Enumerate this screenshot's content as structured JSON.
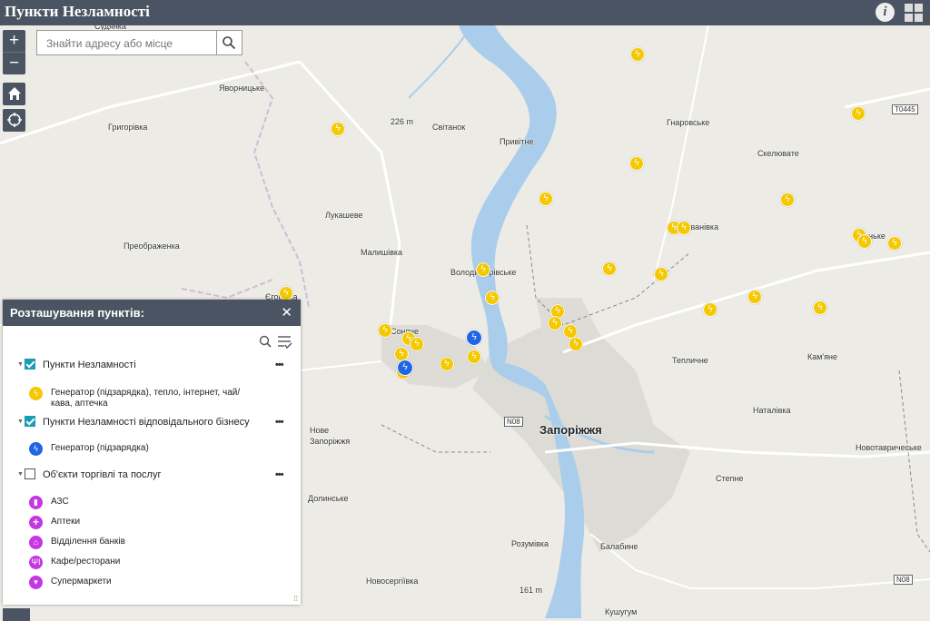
{
  "app": {
    "title": "Пункти Незламності"
  },
  "header": {
    "info_icon": "info-icon",
    "grid_icon": "grid-icon"
  },
  "search": {
    "placeholder": "Знайти адресу або місце"
  },
  "map": {
    "places": [
      {
        "name": "Судянка",
        "city": false
      },
      {
        "name": "Яворницьке",
        "city": false
      },
      {
        "name": "Григорівка",
        "city": false
      },
      {
        "name": "Світанок",
        "city": false
      },
      {
        "name": "Привітне",
        "city": false
      },
      {
        "name": "Гнаровське",
        "city": false
      },
      {
        "name": "Скелювате",
        "city": false
      },
      {
        "name": "Лукашеве",
        "city": false
      },
      {
        "name": "Преображенка",
        "city": false
      },
      {
        "name": "Малишівка",
        "city": false
      },
      {
        "name": "Володимирівське",
        "city": false
      },
      {
        "name": "Соняче",
        "city": false
      },
      {
        "name": "Тепличне",
        "city": false
      },
      {
        "name": "Кам'яне",
        "city": false
      },
      {
        "name": "Наталівка",
        "city": false
      },
      {
        "name": "Запоріжжя",
        "city": true
      },
      {
        "name": "Нове",
        "city": false
      },
      {
        "name": "Запоріжжя",
        "city": false
      },
      {
        "name": "Новотавричеське",
        "city": false
      },
      {
        "name": "Степне",
        "city": false
      },
      {
        "name": "Долинське",
        "city": false
      },
      {
        "name": "Розумівка",
        "city": false
      },
      {
        "name": "Балабине",
        "city": false
      },
      {
        "name": "Новосергіївка",
        "city": false
      },
      {
        "name": "Кушугум",
        "city": false
      },
      {
        "name": "Іванівка",
        "city": false
      },
      {
        "name": "Єгорівка",
        "city": false
      },
      {
        "name": "Біленьке",
        "city": false
      }
    ],
    "road_labels": [
      "T0445",
      "N08",
      "N08"
    ],
    "elevations": [
      "226 m",
      "161 m"
    ]
  },
  "panel": {
    "title": "Розташування пунктів:",
    "layers": [
      {
        "name": "Пункти Незламності",
        "checked": true,
        "legend": [
          {
            "label": "Генератор (підзарядка), тепло, інтернет, чай/кава, аптечка",
            "color": "#f5c800",
            "icon": "lightning-icon"
          }
        ]
      },
      {
        "name": "Пункти Незламності відповідального бізнесу",
        "checked": true,
        "legend": [
          {
            "label": "Генератор (підзарядка)",
            "color": "#1f66e5",
            "icon": "lightning-icon"
          }
        ]
      },
      {
        "name": "Об'єкти торгівлі та послуг",
        "checked": false,
        "legend": [
          {
            "label": "АЗС",
            "color": "#c437e3",
            "icon": "fuel-icon"
          },
          {
            "label": "Аптеки",
            "color": "#c437e3",
            "icon": "pharmacy-cross-icon"
          },
          {
            "label": "Відділення банків",
            "color": "#c437e3",
            "icon": "bank-icon"
          },
          {
            "label": "Кафе/ресторани",
            "color": "#c437e3",
            "icon": "restaurant-icon"
          },
          {
            "label": "Супермаркети",
            "color": "#c437e3",
            "icon": "cart-icon"
          }
        ]
      }
    ]
  }
}
